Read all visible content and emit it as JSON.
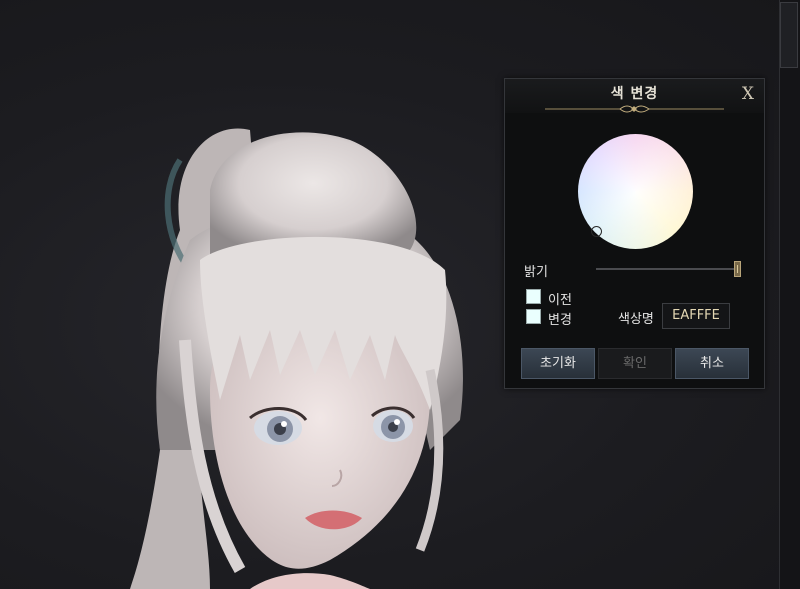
{
  "dialog": {
    "title": "색 변경",
    "close_label": "X",
    "brightness_label": "밝기",
    "brightness_level": 1.0,
    "previous_label": "이전",
    "changed_label": "변경",
    "previous_color": "#EAFFFE",
    "changed_color": "#EAFFFE",
    "hex_label": "색상명",
    "hex_value": "EAFFFE",
    "buttons": {
      "reset": "초기화",
      "confirm": "확인",
      "cancel": "취소"
    }
  },
  "colors": {
    "panel_bg": "#0E0F10",
    "button_active": "#2F3843",
    "gold_accent": "#B9A57A"
  }
}
